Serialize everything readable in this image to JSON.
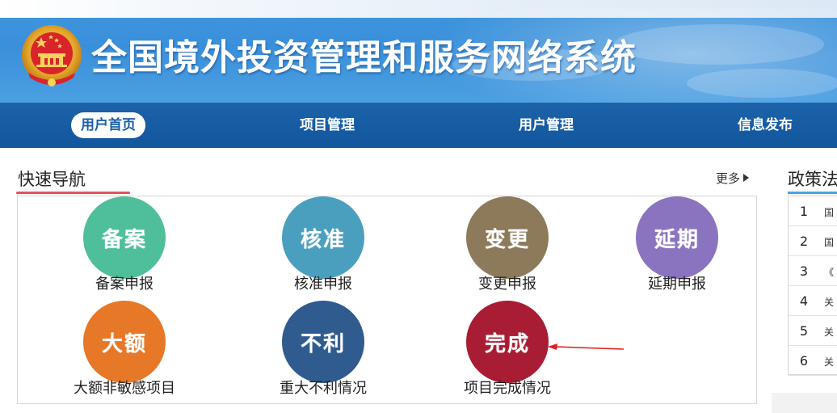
{
  "header": {
    "site_title": "全国境外投资管理和服务网络系统"
  },
  "nav": {
    "items": [
      {
        "label": "用户首页",
        "active": true
      },
      {
        "label": "项目管理",
        "active": false
      },
      {
        "label": "用户管理",
        "active": false
      },
      {
        "label": "信息发布",
        "active": false
      }
    ]
  },
  "quick_nav": {
    "title": "快速导航",
    "more_label": "更多",
    "tiles": [
      {
        "glyph": "备案",
        "label": "备案申报",
        "color": "#4fbf9b"
      },
      {
        "glyph": "核准",
        "label": "核准申报",
        "color": "#4b9fbe"
      },
      {
        "glyph": "变更",
        "label": "变更申报",
        "color": "#8c7a5a"
      },
      {
        "glyph": "延期",
        "label": "延期申报",
        "color": "#8b74bf"
      },
      {
        "glyph": "大额",
        "label": "大额非敏感项目",
        "color": "#e77827"
      },
      {
        "glyph": "不利",
        "label": "重大不利情况",
        "color": "#2f5b8f"
      },
      {
        "glyph": "完成",
        "label": "项目完成情况",
        "color": "#a81d33"
      }
    ]
  },
  "policy": {
    "title": "政策法",
    "rows": [
      {
        "num": "1",
        "text": "国"
      },
      {
        "num": "2",
        "text": "国"
      },
      {
        "num": "3",
        "text": "《"
      },
      {
        "num": "4",
        "text": "关"
      },
      {
        "num": "5",
        "text": "关"
      },
      {
        "num": "6",
        "text": "关"
      }
    ]
  },
  "colors": {
    "banner_blue": "#3f97de",
    "nav_blue": "#1c63aa",
    "accent_red": "#e2545b",
    "annotation_red": "#e02020"
  }
}
